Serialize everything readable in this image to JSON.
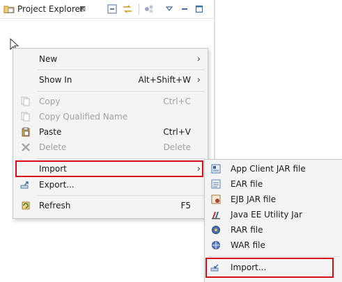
{
  "view": {
    "tab_title": "Project Explorer",
    "tab_close_glyph": "⊠",
    "toolbar": [
      {
        "name": "collapse-all-icon",
        "glyph": "⊟"
      },
      {
        "name": "link-with-editor-icon",
        "glyph": "⇆"
      },
      {
        "name": "filter-icon",
        "glyph": "❖"
      },
      {
        "name": "view-menu-icon",
        "glyph": "▽"
      },
      {
        "name": "minimize-icon",
        "glyph": "▭"
      },
      {
        "name": "maximize-icon",
        "glyph": "□"
      }
    ]
  },
  "context_menu": {
    "new": {
      "label": "New",
      "arrow": "›"
    },
    "show_in": {
      "label": "Show In",
      "shortcut": "Alt+Shift+W",
      "arrow": "›"
    },
    "copy": {
      "label": "Copy",
      "shortcut": "Ctrl+C"
    },
    "copy_qualified": {
      "label": "Copy Qualified Name"
    },
    "paste": {
      "label": "Paste",
      "shortcut": "Ctrl+V"
    },
    "delete": {
      "label": "Delete",
      "shortcut": "Delete"
    },
    "import": {
      "label": "Import",
      "arrow": "›"
    },
    "export": {
      "label": "Export..."
    },
    "refresh": {
      "label": "Refresh",
      "shortcut": "F5"
    }
  },
  "import_submenu": {
    "app_client": {
      "label": "App Client JAR file"
    },
    "ear": {
      "label": "EAR file"
    },
    "ejb": {
      "label": "EJB JAR file"
    },
    "utility": {
      "label": "Java EE Utility Jar"
    },
    "rar": {
      "label": "RAR file"
    },
    "war": {
      "label": "WAR file"
    },
    "import_more": {
      "label": "Import..."
    }
  },
  "colors": {
    "highlight_border": "#d40e14",
    "menu_background": "#f4f4f4",
    "folder_yellow": "#e8b94a"
  }
}
